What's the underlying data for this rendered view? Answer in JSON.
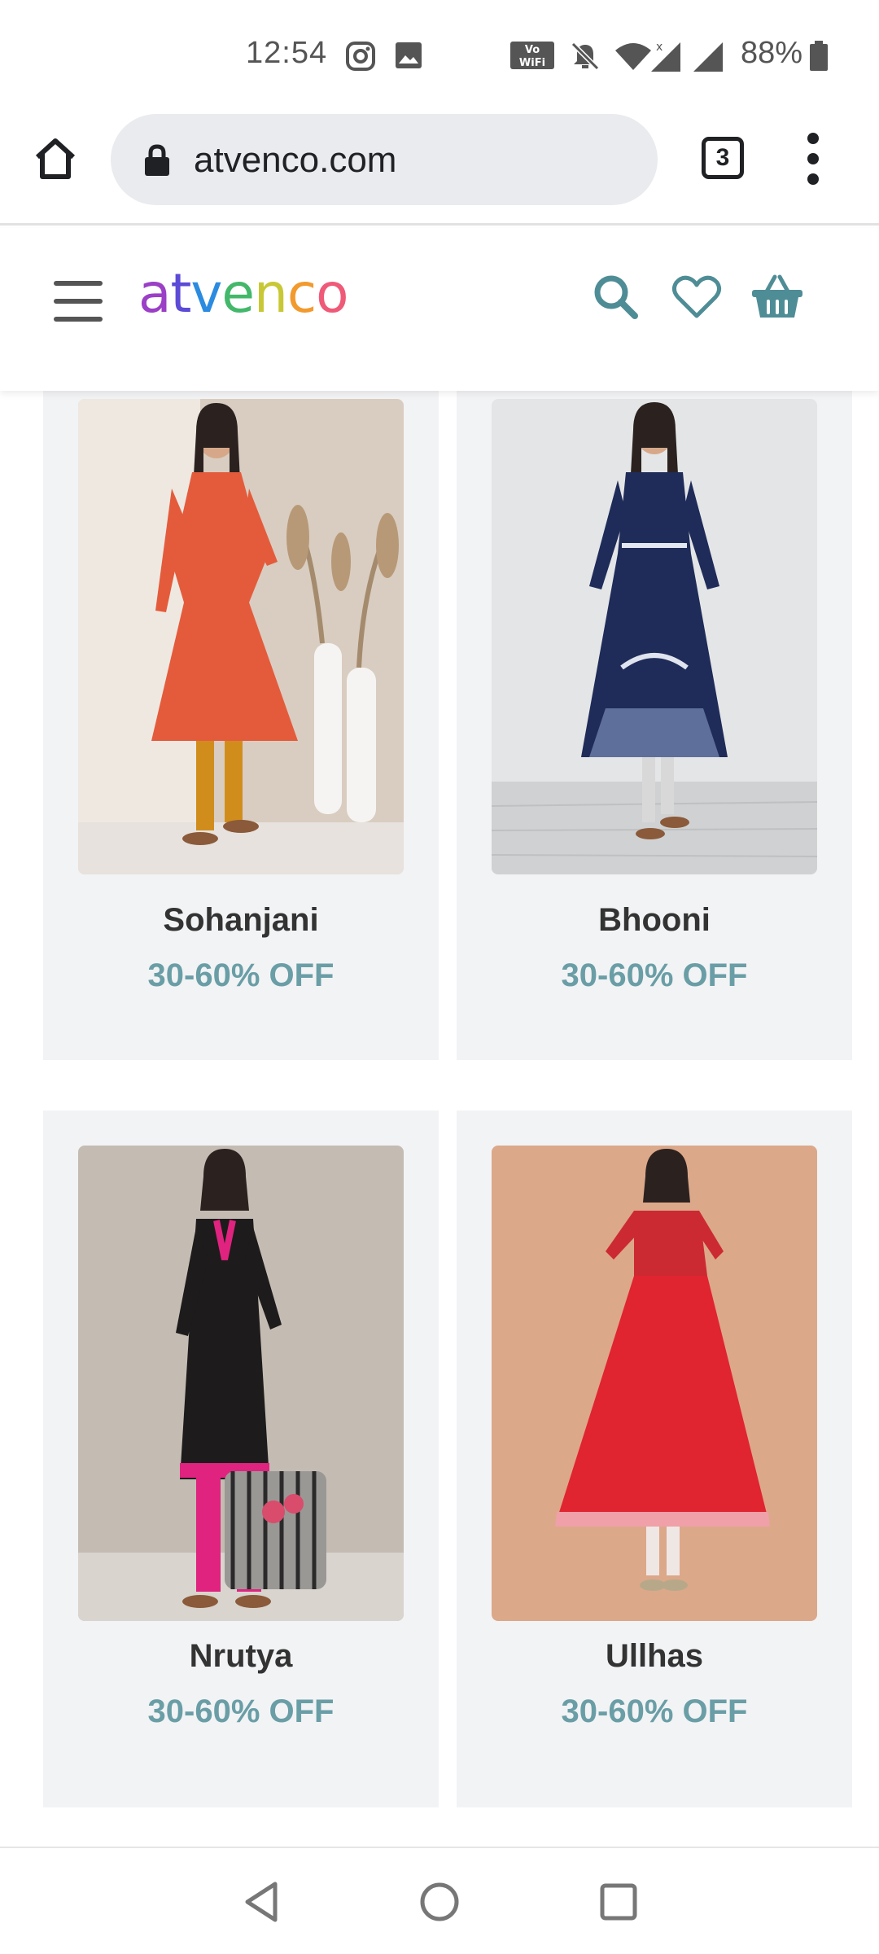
{
  "status_bar": {
    "time": "12:54",
    "battery": "88%",
    "icons": [
      "instagram-icon",
      "gallery-icon",
      "vowifi-icon",
      "mute-icon",
      "wifi-icon",
      "signal-icon",
      "signal-icon-2",
      "battery-icon"
    ]
  },
  "browser": {
    "url": "atvenco.com",
    "tab_count": "3"
  },
  "site": {
    "logo_letters": [
      "a",
      "t",
      "v",
      "e",
      "n",
      "c",
      "o"
    ],
    "logo_colors": [
      "#9b3fc7",
      "#5b4bd6",
      "#2b8be0",
      "#43b86a",
      "#c8c836",
      "#f29a2e",
      "#ef5a78"
    ],
    "accent_color": "#4f8d96"
  },
  "products": [
    {
      "name": "Sohanjani",
      "offer": "30-60% OFF"
    },
    {
      "name": "Bhooni",
      "offer": "30-60% OFF"
    },
    {
      "name": "Nrutya",
      "offer": "30-60% OFF"
    },
    {
      "name": "Ullhas",
      "offer": "30-60% OFF"
    }
  ]
}
